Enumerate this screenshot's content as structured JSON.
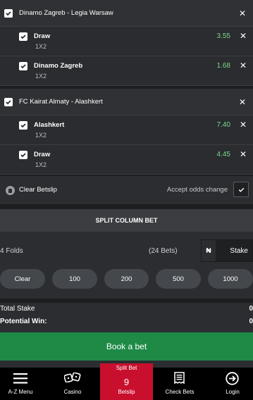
{
  "matches": [
    {
      "title": "Dinamo Zagreb - Legia Warsaw",
      "selections": [
        {
          "name": "Draw",
          "market": "1X2",
          "odds": "3.55"
        },
        {
          "name": "Dinamo Zagreb",
          "market": "1X2",
          "odds": "1.68"
        }
      ]
    },
    {
      "title": "FC Kairat Almaty - Alashkert",
      "selections": [
        {
          "name": "Alashkert",
          "market": "1X2",
          "odds": "7.40"
        },
        {
          "name": "Draw",
          "market": "1X2",
          "odds": "4.45"
        }
      ]
    }
  ],
  "betslip": {
    "clear_label": "Clear Betslip",
    "accept_odds_label": "Accept odds change",
    "split_button": "SPLIT COLUMN BET",
    "folds": "4 Folds",
    "bets_count": "(24 Bets)",
    "currency_symbol": "₦",
    "stake_placeholder": "Stake",
    "quick_stakes": [
      "Clear",
      "100",
      "200",
      "500",
      "1000"
    ],
    "total_stake_label": "Total Stake",
    "total_stake_value": "0",
    "potential_win_label": "Potential Win:",
    "potential_win_value": "0",
    "book_button": "Book a bet"
  },
  "nav": {
    "az_menu": "A-Z Menu",
    "casino": "Casino",
    "split_bet_tag": "Split Bet",
    "betslip_count": "9",
    "betslip": "Betslip",
    "check_bets": "Check Bets",
    "login": "Login"
  },
  "colors": {
    "odds_green": "#7fd88a",
    "book_green": "#1e8a46",
    "betslip_red": "#c8102e",
    "background": "#2b2d30"
  }
}
